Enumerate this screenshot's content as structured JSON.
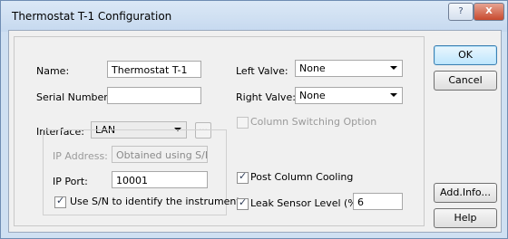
{
  "window": {
    "title": "Thermostat T-1 Configuration",
    "help_glyph": "?",
    "close_glyph": "X"
  },
  "form": {
    "name_label": "Name:",
    "name_value": "Thermostat T-1",
    "serial_label": "Serial Number:",
    "serial_value": "",
    "interface_label": "Interface:",
    "interface_value": "LAN",
    "browse_glyph": "...",
    "ip_address_label": "IP Address:",
    "ip_address_value": "Obtained using S/N",
    "ip_port_label": "IP Port:",
    "ip_port_value": "10001",
    "use_sn_label": "Use S/N to identify the instrument",
    "use_sn_checked": true,
    "left_valve_label": "Left Valve:",
    "left_valve_value": "None",
    "right_valve_label": "Right Valve:",
    "right_valve_value": "None",
    "column_switching_label": "Column Switching Option",
    "column_switching_checked": false,
    "post_cooling_label": "Post Column Cooling",
    "post_cooling_checked": true,
    "leak_sensor_label": "Leak Sensor Level (%):",
    "leak_sensor_checked": true,
    "leak_sensor_value": "6"
  },
  "buttons": {
    "ok": "OK",
    "cancel": "Cancel",
    "add_info": "Add.Info...",
    "help": "Help"
  }
}
